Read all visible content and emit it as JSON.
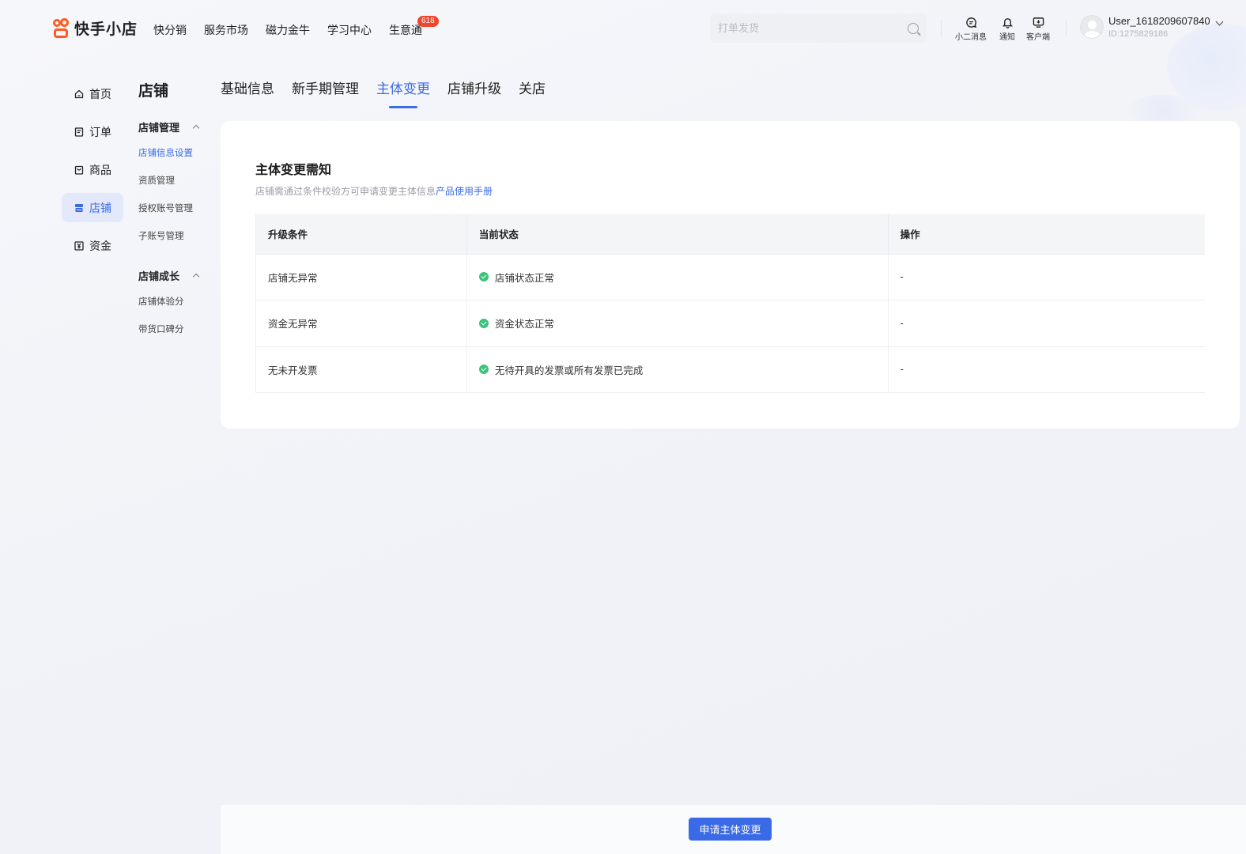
{
  "header": {
    "brand": "快手小店",
    "nav": [
      {
        "label": "快分销"
      },
      {
        "label": "服务市场"
      },
      {
        "label": "磁力金牛"
      },
      {
        "label": "学习中心"
      },
      {
        "label": "生意通",
        "badge": "618"
      }
    ],
    "search_placeholder": "打单发货",
    "tools": [
      {
        "label": "小二消息",
        "icon": "chat-icon"
      },
      {
        "label": "通知",
        "icon": "bell-icon"
      },
      {
        "label": "客户端",
        "icon": "monitor-icon"
      }
    ],
    "user": {
      "name": "User_1618209607840",
      "id": "ID:1275829186"
    }
  },
  "leftnav": [
    {
      "label": "首页",
      "icon": "home-icon",
      "active": false
    },
    {
      "label": "订单",
      "icon": "order-icon",
      "active": false
    },
    {
      "label": "商品",
      "icon": "bag-icon",
      "active": false
    },
    {
      "label": "店铺",
      "icon": "store-icon",
      "active": true
    },
    {
      "label": "资金",
      "icon": "yen-icon",
      "active": false
    }
  ],
  "subnav": {
    "title": "店铺",
    "groups": [
      {
        "label": "店铺管理",
        "items": [
          "店铺信息设置",
          "资质管理",
          "授权账号管理",
          "子账号管理"
        ]
      },
      {
        "label": "店铺成长",
        "items": [
          "店铺体验分",
          "带货口碑分"
        ]
      }
    ]
  },
  "tabs": [
    "基础信息",
    "新手期管理",
    "主体变更",
    "店铺升级",
    "关店"
  ],
  "active_tab": "主体变更",
  "card": {
    "title": "主体变更需知",
    "desc": "店铺需通过条件校验方可申请变更主体信息",
    "desc_link": "产品使用手册",
    "columns": [
      "升级条件",
      "当前状态",
      "操作"
    ],
    "rows": [
      {
        "condition": "店铺无异常",
        "status": "店铺状态正常",
        "action": "-"
      },
      {
        "condition": "资金无异常",
        "status": "资金状态正常",
        "action": "-"
      },
      {
        "condition": "无未开发票",
        "status": "无待开具的发票或所有发票已完成",
        "action": "-"
      }
    ]
  },
  "footer": {
    "submit_label": "申请主体变更"
  },
  "colors": {
    "accent": "#3a6ae6",
    "brand": "#ff5a1f",
    "success": "#3ec37a",
    "badge": "#f0462d"
  }
}
